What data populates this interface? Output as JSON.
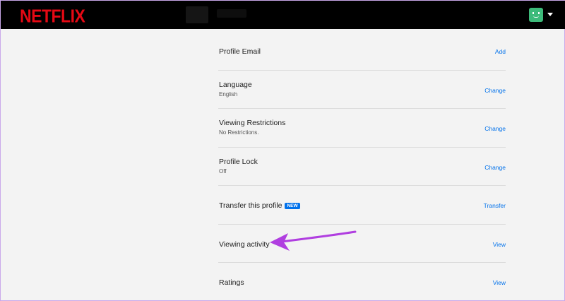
{
  "header": {
    "logo_text": "NETFLIX",
    "brand_color": "#e50914",
    "avatar_color": "#3dba7a"
  },
  "settings": [
    {
      "title": "Profile Email",
      "subtitle": "",
      "action": "Add",
      "badge": ""
    },
    {
      "title": "Language",
      "subtitle": "English",
      "action": "Change",
      "badge": ""
    },
    {
      "title": "Viewing Restrictions",
      "subtitle": "No Restrictions.",
      "action": "Change",
      "badge": ""
    },
    {
      "title": "Profile Lock",
      "subtitle": "Off",
      "action": "Change",
      "badge": ""
    },
    {
      "title": "Transfer this profile",
      "subtitle": "",
      "action": "Transfer",
      "badge": "NEW"
    },
    {
      "title": "Viewing activity",
      "subtitle": "",
      "action": "View",
      "badge": ""
    },
    {
      "title": "Ratings",
      "subtitle": "",
      "action": "View",
      "badge": ""
    }
  ],
  "annotation": {
    "arrow_color": "#b03ee0",
    "points_to": "Viewing activity"
  },
  "colors": {
    "link": "#0071eb",
    "background": "#f3f3f3"
  }
}
